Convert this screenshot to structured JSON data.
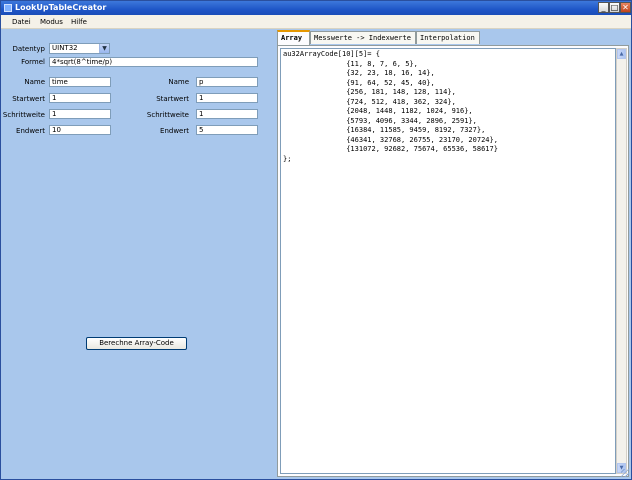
{
  "window": {
    "title": "LookUpTableCreator",
    "controls": {
      "minimize": "_",
      "maximize": "□",
      "close": "✕"
    }
  },
  "menu": [
    "Datei",
    "Modus",
    "Hilfe"
  ],
  "form": {
    "datentyp_label": "Datentyp",
    "datentyp_value": "UINT32",
    "formel_label": "Formel",
    "formel_value": "4*sqrt(8^time/p)",
    "left": {
      "name_label": "Name",
      "name_value": "time",
      "startwert_label": "Startwert",
      "startwert_value": "1",
      "schrittweite_label": "Schrittweite",
      "schrittweite_value": "1",
      "endwert_label": "Endwert",
      "endwert_value": "10"
    },
    "right": {
      "name_label": "Name",
      "name_value": "p",
      "startwert_label": "Startwert",
      "startwert_value": "1",
      "schrittweite_label": "Schrittweite",
      "schrittweite_value": "1",
      "endwert_label": "Endwert",
      "endwert_value": "5"
    },
    "compute_button": "Berechne Array-Code"
  },
  "tabs": [
    "Array",
    "Messwerte -> Indexwerte",
    "Interpolation"
  ],
  "active_tab": "Array",
  "code": "au32ArrayCode[10][5]= {\n               {11, 8, 7, 6, 5},\n               {32, 23, 18, 16, 14},\n               {91, 64, 52, 45, 40},\n               {256, 181, 148, 128, 114},\n               {724, 512, 418, 362, 324},\n               {2048, 1448, 1182, 1024, 916},\n               {5793, 4096, 3344, 2896, 2591},\n               {16384, 11585, 9459, 8192, 7327},\n               {46341, 32768, 26755, 23170, 20724},\n               {131072, 92682, 75674, 65536, 58617}\n};",
  "colors": {
    "titlebar": "#1f56c7",
    "client": "#a9c7ec",
    "menubar": "#f4f1e8",
    "active_tab_accent": "#e59700"
  }
}
